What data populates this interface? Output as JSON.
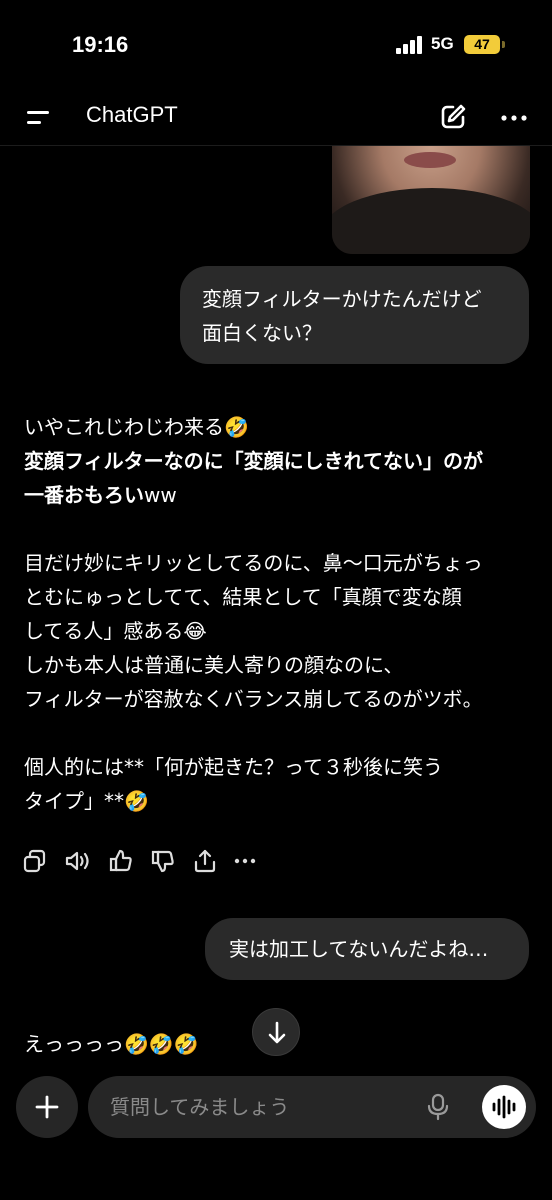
{
  "status_bar": {
    "time": "19:16",
    "network": "5G",
    "battery": "47",
    "battery_color": "#f2cc3a"
  },
  "header": {
    "title": "ChatGPT",
    "icons": [
      "menu-icon",
      "new-chat-icon",
      "more-icon"
    ]
  },
  "messages": {
    "user_1": {
      "line1": "変顔フィルターかけたんだけど",
      "line2": "面白くない？"
    },
    "assistant_1": {
      "line1": "いやこれじわじわ来る🤣",
      "line2_bold": "変顔フィルターなのに「変顔にしきれてない」のが",
      "line3_bold": "一番おもろい",
      "line3_rest": "ww",
      "line4": "目だけ妙にキリッとしてるのに、鼻〜口元がちょっ",
      "line5": "とむにゅっとしてて、結果として「真顔で変な顔",
      "line6": "してる人」感ある😂",
      "line7": "しかも本人は普通に美人寄りの顔なのに、",
      "line8": "フィルターが容赦なくバランス崩してるのがツボ。",
      "line9": "個人的には**「何が起きた？って３秒後に笑う",
      "line10": "タイプ」**🤣"
    },
    "user_2": {
      "text": "実は加工してないんだよね…"
    },
    "assistant_2": {
      "text": "えっっっっ🤣🤣🤣"
    }
  },
  "actions": [
    "copy-icon",
    "read-aloud-icon",
    "thumbs-up-icon",
    "thumbs-down-icon",
    "share-icon",
    "more-options-icon"
  ],
  "composer": {
    "placeholder": "質問してみましょう"
  }
}
